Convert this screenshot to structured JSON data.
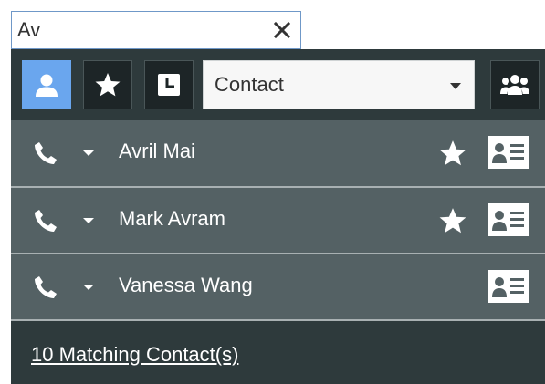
{
  "search": {
    "value": "Av",
    "clear_icon": "close-icon"
  },
  "toolbar": {
    "buttons": [
      {
        "icon": "person-icon",
        "active": true
      },
      {
        "icon": "star-icon",
        "active": false
      },
      {
        "icon": "clock-icon",
        "active": false
      }
    ],
    "type_select": {
      "selected": "Contact"
    },
    "group_icon": "group-icon"
  },
  "results": [
    {
      "name": "Avril Mai",
      "favorite": true
    },
    {
      "name": "Mark Avram",
      "favorite": true
    },
    {
      "name": "Vanessa Wang",
      "favorite": false
    }
  ],
  "footer": {
    "matching_text": "10 Matching Contact(s)"
  },
  "colors": {
    "accent": "#6aa6ee",
    "panel": "#2e3a3c",
    "row": "#546164"
  }
}
